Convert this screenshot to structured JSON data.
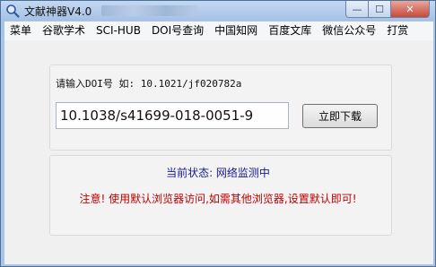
{
  "window": {
    "title": "文献神器V4.0",
    "buttons": {
      "minimize": "—",
      "maximize": "☐",
      "close": "✕"
    }
  },
  "menu": {
    "items": [
      "菜单",
      "谷歌学术",
      "SCI-HUB",
      "DOI号查询",
      "中国知网",
      "百度文库",
      "微信公众号",
      "打赏"
    ]
  },
  "form": {
    "prompt": "请输入DOI号 如: 10.1021/jf020782a",
    "doi_value": "10.1038/s41699-018-0051-9",
    "download_label": "立即下载"
  },
  "status": {
    "text": "当前状态: 网络监测中"
  },
  "notice": {
    "text": "注意!  使用默认浏览器访问,如需其他浏览器,设置默认即可!"
  },
  "colors": {
    "status": "#1a1a8c",
    "notice": "#c00000",
    "titlebar": "#a9c4e6"
  }
}
